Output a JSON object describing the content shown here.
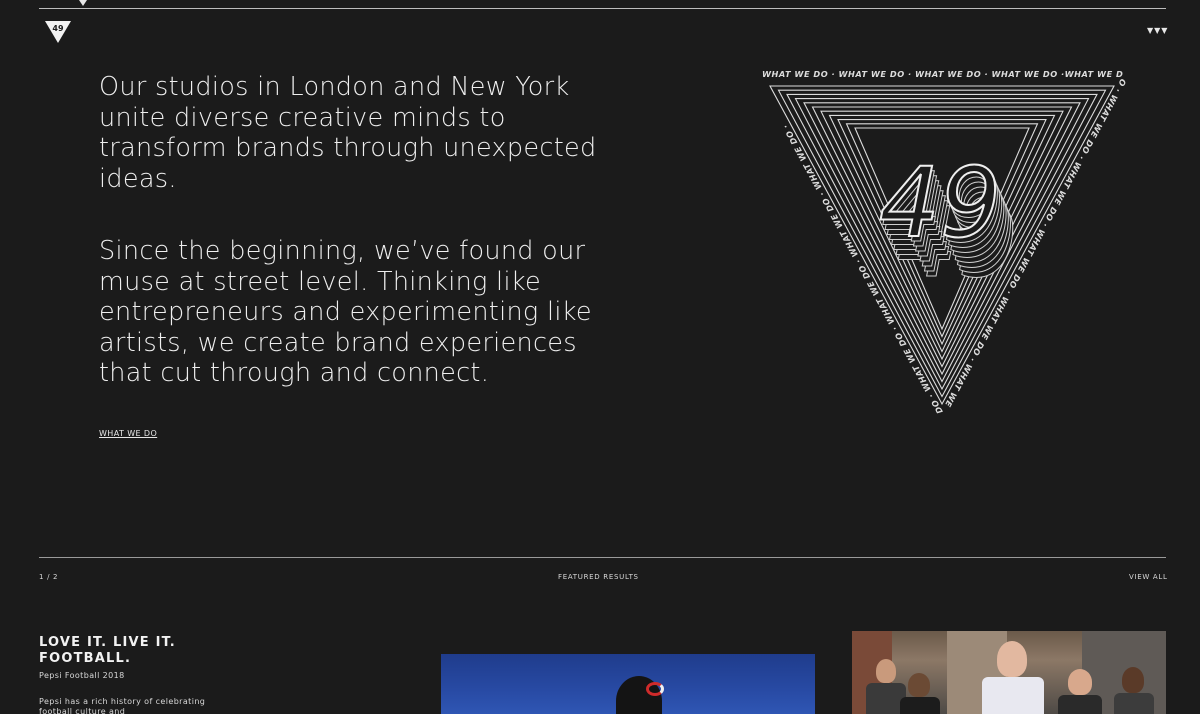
{
  "brand": {
    "logo_text": "49"
  },
  "header": {
    "menu_icon": "triangle-menu-icon",
    "menu_glyph": "▼▼▼"
  },
  "intro": {
    "paragraph_1": "Our studios in London and New York unite diverse creative minds to transform brands through unexpected ideas.",
    "paragraph_2": "Since the beginning, we’ve found our muse at street level. Thinking like entrepreneurs and experimenting like artists, we create brand experiences that cut through and connect.",
    "cta_label": "WHAT WE DO"
  },
  "emblem": {
    "ring_text": "WHAT WE DO · WHAT WE DO · WHAT WE DO · WHAT WE DO ·WHAT WE DO · WHAT WE DO · WHAT WE DO · WHAT WE DO · WHAT WE DO · WHAT WE DO · WHAT WE DO · WHAT WE DO · WHAT WE DO · WHAT WE DO · ",
    "number": "49"
  },
  "featured": {
    "counter": "1 / 2",
    "title": "FEATURED RESULTS",
    "view_all_label": "VIEW ALL"
  },
  "card": {
    "title": "LOVE IT. LIVE IT. FOOTBALL.",
    "subtitle": "Pepsi Football 2018",
    "description": "Pepsi has a rich history of celebrating football culture and"
  },
  "colors": {
    "background": "#1b1b1b",
    "text": "#ececec",
    "rule": "#9a9a9a",
    "image_blue": "#2848a4"
  }
}
